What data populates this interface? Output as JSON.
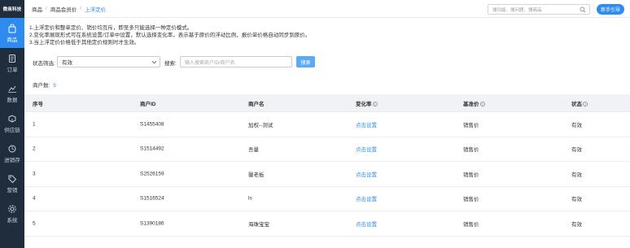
{
  "sidebar": {
    "logo": "微商科技",
    "items": [
      {
        "label": "商品",
        "icon": "shop-bag-icon",
        "active": true
      },
      {
        "label": "订单",
        "icon": "order-list-icon",
        "active": false
      },
      {
        "label": "数据",
        "icon": "chart-line-icon",
        "active": false
      },
      {
        "label": "供应链",
        "icon": "supply-chain-icon",
        "active": false
      },
      {
        "label": "进销存",
        "icon": "inventory-icon",
        "active": false
      },
      {
        "label": "营销",
        "icon": "marketing-tag-icon",
        "active": false
      },
      {
        "label": "系统",
        "icon": "gear-icon",
        "active": false
      }
    ]
  },
  "breadcrumb": [
    "商品",
    "商品会员价",
    "上浮定价"
  ],
  "topbar": {
    "search_placeholder": "搜功能、搜问题、搜商品",
    "guide_button": "新手引导"
  },
  "notes": [
    "1.上浮定价和整单定价、销价均互斥，即至多只能选择一种定价模式。",
    "2.变化率展现形式可在系统设置/订单中设置，默认选择变化率，表示基于原价的浮动比例，报价单价格自动同步到原价。",
    "3.当上浮定价价格低于其他定价规则时才生效。"
  ],
  "filter": {
    "status_label": "状态筛选:",
    "status_value": "有效",
    "keyword_label": "搜索:",
    "keyword_placeholder": "输入搜索商户ID/商户名",
    "search_button": "搜索"
  },
  "count": {
    "label": "商户数:",
    "value": "5"
  },
  "table": {
    "headers": [
      "序号",
      "商户ID",
      "商户名",
      "变化率",
      "基准价",
      "状态"
    ],
    "rows": [
      {
        "no": "1",
        "id": "S1455408",
        "name": "加权--测试",
        "rate": "点击设置",
        "base": "销售价",
        "status": "有效"
      },
      {
        "no": "2",
        "id": "S1514492",
        "name": "吾量",
        "rate": "点击设置",
        "base": "销售价",
        "status": "有效"
      },
      {
        "no": "3",
        "id": "S2526159",
        "name": "馨老板",
        "rate": "点击设置",
        "base": "销售价",
        "status": "有效"
      },
      {
        "no": "4",
        "id": "S1516524",
        "name": "ls",
        "rate": "点击设置",
        "base": "销售价",
        "status": "有效"
      },
      {
        "no": "5",
        "id": "S1390186",
        "name": "海珠宝宝",
        "rate": "点击设置",
        "base": "销售价",
        "status": "有效"
      }
    ]
  },
  "colors": {
    "accent": "#2e8cf0",
    "sidebar": "#1f2d3d"
  }
}
